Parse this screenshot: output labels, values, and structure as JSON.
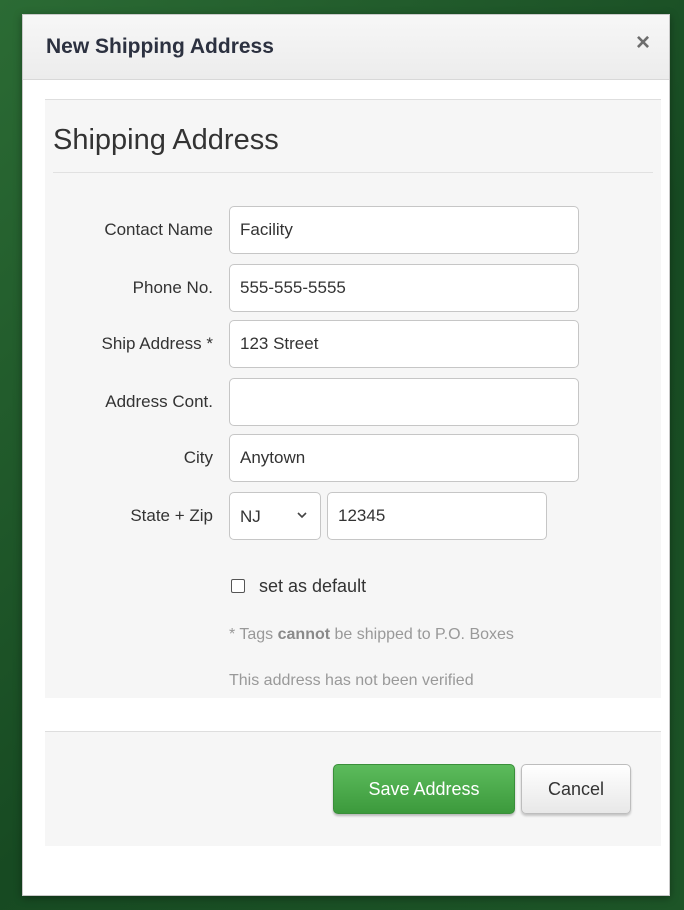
{
  "modal": {
    "title": "New Shipping Address",
    "close_label": "×"
  },
  "form": {
    "section_title": "Shipping Address",
    "fields": {
      "contact_name": {
        "label": "Contact Name",
        "value": "Facility"
      },
      "phone": {
        "label": "Phone No.",
        "value": "555-555-5555"
      },
      "ship_address": {
        "label": "Ship Address *",
        "value": "123 Street"
      },
      "address_cont": {
        "label": "Address Cont.",
        "value": ""
      },
      "city": {
        "label": "City",
        "value": "Anytown"
      },
      "state_zip": {
        "label": "State + Zip",
        "state": "NJ",
        "zip": "12345"
      }
    },
    "default_checkbox": {
      "label": "set as default",
      "checked": false
    },
    "note_prefix": "* Tags ",
    "note_emphasis": "cannot",
    "note_suffix": " be shipped to P.O. Boxes",
    "verification_status": "This address has not been verified"
  },
  "footer": {
    "save_label": "Save Address",
    "cancel_label": "Cancel"
  },
  "colors": {
    "backdrop": "#1f5a2a",
    "save_button": "#4cae4c",
    "panel": "#f6f6f6"
  },
  "icons": {
    "close": "close-icon",
    "select_chevron": "chevron-down-icon"
  }
}
